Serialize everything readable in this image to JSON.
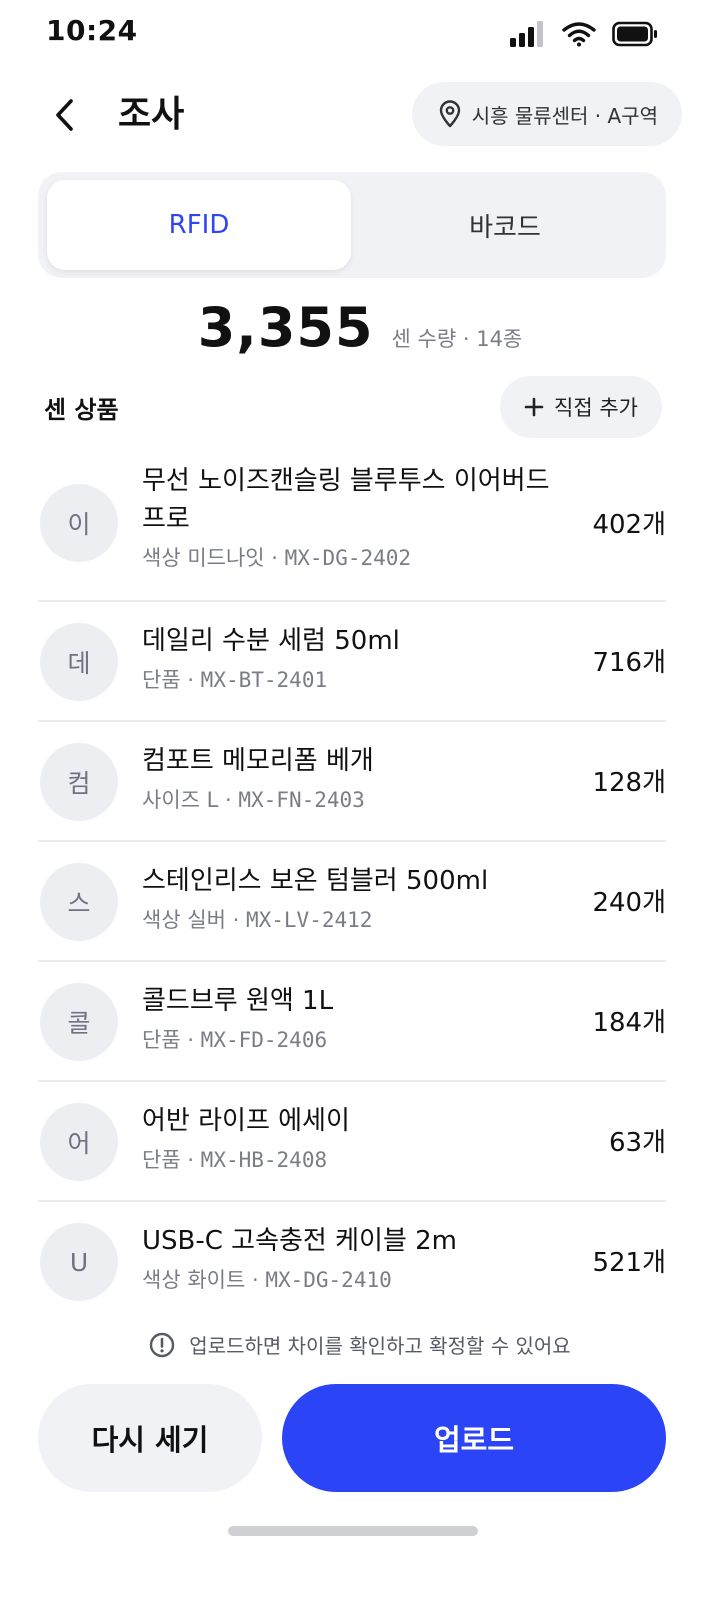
{
  "status_bar": {
    "time": "10:24"
  },
  "header": {
    "title": "조사",
    "location": "시흥 물류센터 · A구역"
  },
  "segments": {
    "rfid": "RFID",
    "barcode": "바코드"
  },
  "summary": {
    "count": "3,355",
    "label": "센 수량 · 14종"
  },
  "section": {
    "title": "센 상품",
    "add_label": "직접 추가"
  },
  "products": [
    {
      "avatar": "이",
      "name": "무선 노이즈캔슬링 블루투스 이어버드 프로",
      "option": "색상 미드나잇 · ",
      "sku": "MX-DG-2402",
      "qty": "402개"
    },
    {
      "avatar": "데",
      "name": "데일리 수분 세럼 50ml",
      "option": "단품 · ",
      "sku": "MX-BT-2401",
      "qty": "716개"
    },
    {
      "avatar": "컴",
      "name": "컴포트 메모리폼 베개",
      "option": "사이즈 L · ",
      "sku": "MX-FN-2403",
      "qty": "128개"
    },
    {
      "avatar": "스",
      "name": "스테인리스 보온 텀블러 500ml",
      "option": "색상 실버 · ",
      "sku": "MX-LV-2412",
      "qty": "240개"
    },
    {
      "avatar": "콜",
      "name": "콜드브루 원액 1L",
      "option": "단품 · ",
      "sku": "MX-FD-2406",
      "qty": "184개"
    },
    {
      "avatar": "어",
      "name": "어반 라이프 에세이",
      "option": "단품 · ",
      "sku": "MX-HB-2408",
      "qty": "63개"
    },
    {
      "avatar": "U",
      "name": "USB-C 고속충전 케이블 2m",
      "option": "색상 화이트 · ",
      "sku": "MX-DG-2410",
      "qty": "521개"
    }
  ],
  "bottom": {
    "notice": "업로드하면 차이를 확인하고 확정할 수 있어요",
    "retry_label": "다시 세기",
    "upload_label": "업로드"
  },
  "colors": {
    "accent": "#2b44f5",
    "chip_bg": "#f1f2f6",
    "muted_text": "#7a7d86"
  }
}
